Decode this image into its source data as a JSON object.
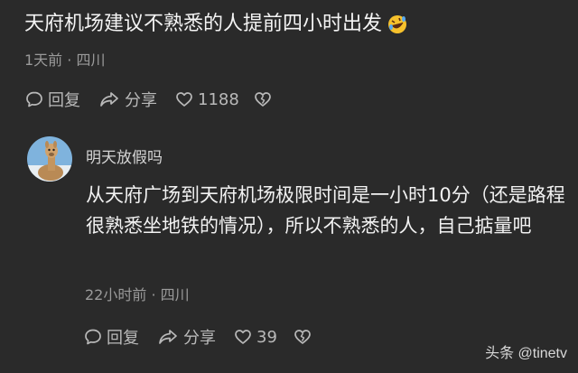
{
  "post": {
    "text": "天府机场建议不熟悉的人提前四小时出发",
    "emoji_icon": "rolling-on-floor-laughing-icon",
    "meta": "1天前 · 四川",
    "actions": {
      "reply_label": "回复",
      "share_label": "分享",
      "like_count": "1188"
    }
  },
  "reply": {
    "username": "明天放假吗",
    "avatar_icon": "alpaca-avatar",
    "text": "从天府广场到天府机场极限时间是一小时10分（还是路程很熟悉坐地铁的情况），所以不熟悉的人，自己掂量吧",
    "meta": "22小时前 · 四川",
    "actions": {
      "reply_label": "回复",
      "share_label": "分享",
      "like_count": "39"
    }
  },
  "watermark": "头条 @tinetv",
  "colors": {
    "background": "#2a2a2a",
    "primary_text": "#f2f2f2",
    "secondary_text": "#9a9a9a",
    "action_text": "#b9b9b9"
  }
}
